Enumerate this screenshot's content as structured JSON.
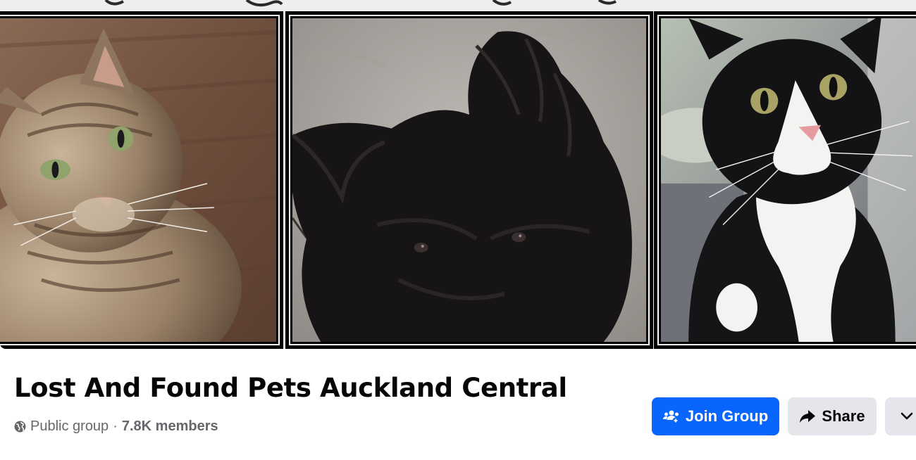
{
  "cover": {
    "images": [
      {
        "subject": "tabby cat"
      },
      {
        "subject": "black scruffy dog"
      },
      {
        "subject": "black and white tuxedo cat"
      }
    ]
  },
  "group": {
    "title": "Lost And Found Pets Auckland Central",
    "privacy": "Public group",
    "separator": "·",
    "members": "7.8K members"
  },
  "actions": {
    "join_label": "Join Group",
    "share_label": "Share",
    "more_icon": "chevron-down-icon"
  },
  "colors": {
    "primary": "#0866ff",
    "secondary_button": "#e4e6eb",
    "text": "#050505",
    "muted_text": "#65676b"
  }
}
